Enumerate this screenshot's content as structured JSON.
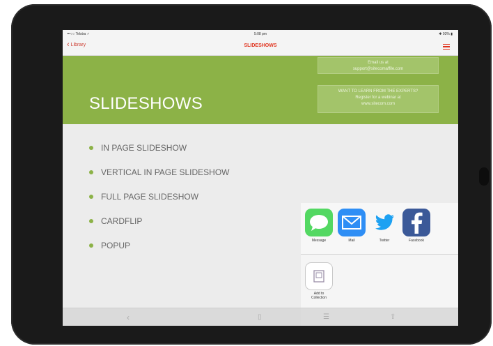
{
  "status_bar": {
    "carrier": "•••○○ Telstra ✓",
    "time": "5:08 pm",
    "battery": "✱ 93% ▮"
  },
  "nav": {
    "back_label": "Library",
    "title": "SLIDESHOWS"
  },
  "banner": {
    "title": "SLIDESHOWS",
    "email_box": [
      "Email us at",
      "support@sitecomaffile.com"
    ],
    "learn_box": [
      "WANT TO LEARN FROM THE EXPERTS?",
      "Register for a webinar at",
      "www.sitecom.com"
    ]
  },
  "list": {
    "items": [
      {
        "label": "IN PAGE SLIDESHOW"
      },
      {
        "label": "VERTICAL IN PAGE SLIDESHOW"
      },
      {
        "label": "FULL PAGE SLIDESHOW"
      },
      {
        "label": "CARDFLIP"
      },
      {
        "label": "POPUP"
      }
    ]
  },
  "share_sheet": {
    "apps": [
      {
        "label": "Message",
        "icon": "message-icon",
        "color": "#53d862"
      },
      {
        "label": "Mail",
        "icon": "mail-icon",
        "color": "#2e8ef5"
      },
      {
        "label": "Twitter",
        "icon": "twitter-icon",
        "color": "#1da1f2"
      },
      {
        "label": "Facebook",
        "icon": "facebook-icon",
        "color": "#3b5998"
      }
    ],
    "actions": [
      {
        "label_line1": "Add to",
        "label_line2": "Collection",
        "icon": "collection-icon"
      }
    ]
  },
  "toolbar": {
    "icons": [
      "back-arrow-icon",
      "page-icon",
      "list-icon",
      "share-icon"
    ]
  },
  "colors": {
    "accent": "#e0321c",
    "banner_green": "#8cb247"
  }
}
